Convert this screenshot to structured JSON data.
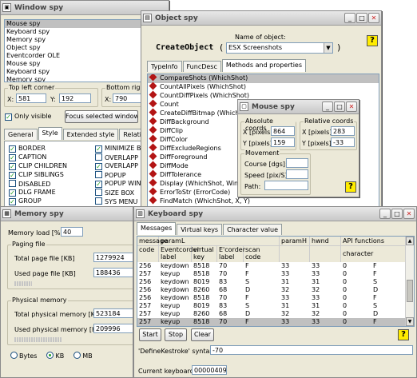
{
  "window_spy": {
    "title": "Window spy",
    "items": [
      "Mouse spy",
      "Keyboard spy",
      "Memory spy",
      "Object spy",
      "Eventcorder OLE",
      "Mouse spy",
      "Keyboard spy",
      "Memory spy"
    ],
    "top_left_label": "Top left corner",
    "x_label": "X:",
    "y_label": "Y:",
    "top_left_x": "581",
    "top_left_y": "192",
    "bottom_right_label": "Bottom right c",
    "bottom_right_x": "790",
    "only_visible": "Only visible",
    "focus_button": "Focus selected window",
    "tabs": [
      "General",
      "Style",
      "Extended style",
      "Relations"
    ],
    "styles_left": [
      "BORDER",
      "CAPTION",
      "CLIP CHILDREN",
      "CLIP SIBLINGS",
      "DISABLED",
      "DLG FRAME",
      "GROUP"
    ],
    "styles_left_checked": [
      true,
      true,
      true,
      true,
      false,
      true,
      true
    ],
    "styles_right": [
      "MINIMIZE B",
      "OVERLAPP",
      "OVERLAPP",
      "POPUP",
      "POPUP WIN",
      "SIZE BOX",
      "SYS MENU"
    ],
    "styles_right_checked": [
      true,
      false,
      true,
      false,
      true,
      false,
      false
    ]
  },
  "object_spy": {
    "title": "Object spy",
    "name_label": "Name of object:",
    "create_object": "CreateObject",
    "open_paren": "(",
    "close_paren": ")",
    "object_name": "ESX Screenshots",
    "tabs": [
      "TypeInfo",
      "FuncDesc",
      "Methods and properties"
    ],
    "methods": [
      "CompareShots (WhichShot)",
      "CountAllPixels (WhichShot)",
      "CountDiffPixels (WhichShot)",
      "Count",
      "CreateDiffBitmap (WhichShot)",
      "DiffBackground",
      "DiffClip",
      "DiffColor",
      "DiffExcludeRegions",
      "DiffForeground",
      "DiffMode",
      "DiffTolerance",
      "Display (WhichShot, Win",
      "ErrorToStr (ErrorCode)",
      "FindMatch (WhichShot, X, Y)"
    ],
    "help": "?"
  },
  "mouse_spy": {
    "title": "Mouse spy",
    "absolute_label": "Absolute coords",
    "relative_label": "Relative coords",
    "x_label": "X [pixels]:",
    "y_label": "Y [pixels]:",
    "abs_x": "864",
    "abs_y": "159",
    "rel_x": "283",
    "rel_y": "-33",
    "movement_label": "Movement",
    "course_label": "Course [dgs]:",
    "speed_label": "Speed [pix/S]:",
    "path_label": "Path:",
    "course_value": "",
    "speed_value": "",
    "path_value": "",
    "help": "?"
  },
  "memory_spy": {
    "title": "Memory spy",
    "load_label": "Memory load [%]:",
    "load_value": "40",
    "paging_label": "Paging file",
    "total_page_label": "Total page file [KB]",
    "total_page_value": "1279924",
    "used_page_label": "Used page file [KB]",
    "used_page_value": "188436",
    "physical_label": "Physical memory",
    "total_phys_label": "Total physical memory [KB]",
    "total_phys_value": "523184",
    "used_phys_label": "Used physical memory [KB]",
    "used_phys_value": "209996",
    "units": [
      "Bytes",
      "KB",
      "MB"
    ],
    "selected_unit": "KB",
    "paging_used_fraction": 0.15,
    "physical_used_fraction": 0.4
  },
  "keyboard_spy": {
    "title": "Keyboard spy",
    "tabs": [
      "Messages",
      "Virtual keys",
      "Character value"
    ],
    "head1": [
      "message",
      "paramL",
      "",
      "",
      "",
      "paramH",
      "hwnd",
      "API functions"
    ],
    "head2": [
      "code",
      "Eventcorder label",
      "virtual key",
      "E'corder label",
      "scan code",
      "",
      "",
      "character"
    ],
    "rows": [
      [
        "256",
        "keydown",
        "8518",
        "70",
        "F",
        "33",
        "33",
        "0",
        "F"
      ],
      [
        "257",
        "keyup",
        "8518",
        "70",
        "F",
        "33",
        "33",
        "0",
        "F"
      ],
      [
        "256",
        "keydown",
        "8019",
        "83",
        "S",
        "31",
        "31",
        "0",
        "S"
      ],
      [
        "256",
        "keydown",
        "8260",
        "68",
        "D",
        "32",
        "32",
        "0",
        "D"
      ],
      [
        "256",
        "keydown",
        "8518",
        "70",
        "F",
        "33",
        "33",
        "0",
        "F"
      ],
      [
        "257",
        "keyup",
        "8019",
        "83",
        "S",
        "31",
        "31",
        "0",
        "S"
      ],
      [
        "257",
        "keyup",
        "8260",
        "68",
        "D",
        "32",
        "32",
        "0",
        "D"
      ],
      [
        "257",
        "keyup",
        "8518",
        "70",
        "F",
        "33",
        "33",
        "0",
        "F"
      ]
    ],
    "start_label": "Start",
    "stop_label": "Stop",
    "clear_label": "Clear",
    "syntax_label": "'DefineKestroke' syntax:",
    "syntax_value": "-70",
    "current_label": "Current keyboard:",
    "current_value": "00000409",
    "help": "?"
  }
}
